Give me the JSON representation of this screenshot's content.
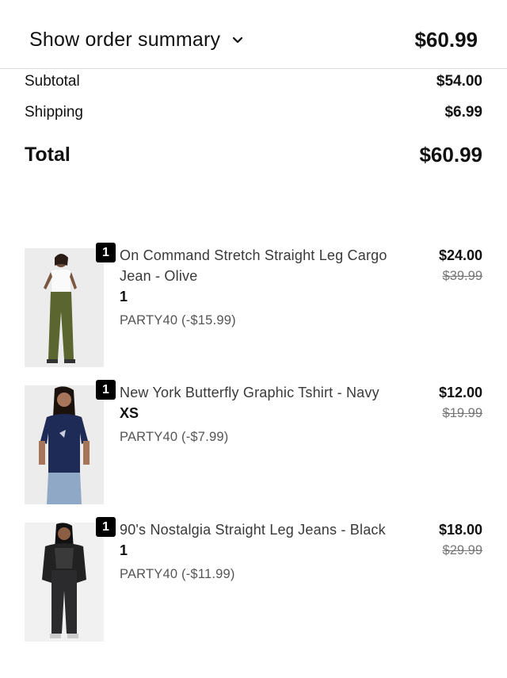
{
  "header": {
    "toggle_label": "Show order summary",
    "total": "$60.99"
  },
  "summary": {
    "subtotal_label": "Subtotal",
    "subtotal_value": "$54.00",
    "shipping_label": "Shipping",
    "shipping_value": "$6.99",
    "total_label": "Total",
    "total_value": "$60.99"
  },
  "items": [
    {
      "quantity": "1",
      "name": "On Command Stretch Straight Leg Cargo Jean - Olive",
      "variant": "1",
      "discount": "PARTY40 (-$15.99)",
      "price": "$24.00",
      "original_price": "$39.99"
    },
    {
      "quantity": "1",
      "name": "New York Butterfly Graphic Tshirt - Navy",
      "variant": "XS",
      "discount": "PARTY40 (-$7.99)",
      "price": "$12.00",
      "original_price": "$19.99"
    },
    {
      "quantity": "1",
      "name": "90's Nostalgia Straight Leg Jeans - Black",
      "variant": "1",
      "discount": "PARTY40 (-$11.99)",
      "price": "$18.00",
      "original_price": "$29.99"
    }
  ],
  "colors": {
    "text": "#111111",
    "muted": "#555555",
    "badge": "#000000",
    "divider": "#dcdcdc"
  },
  "icons": {
    "toggle": "chevron-down-icon"
  }
}
